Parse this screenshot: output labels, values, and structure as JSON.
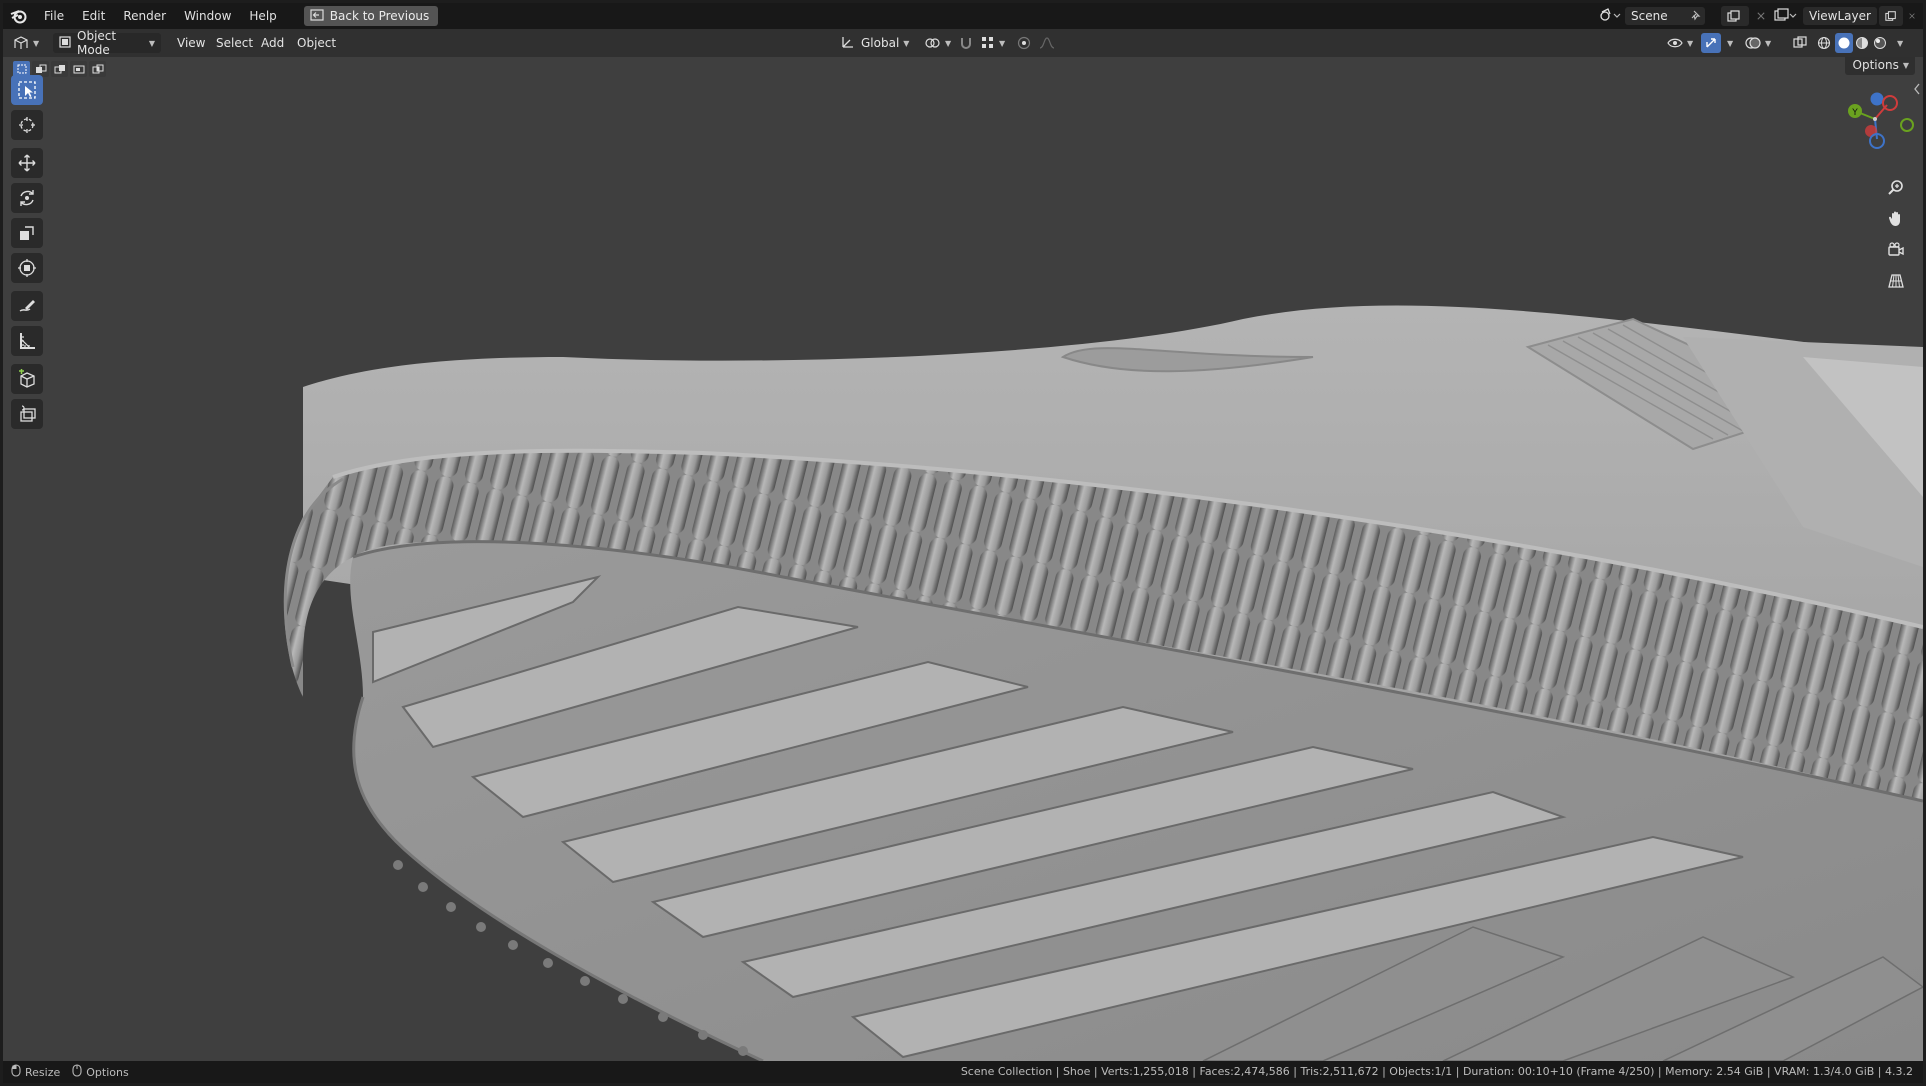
{
  "menubar": {
    "items": [
      "File",
      "Edit",
      "Render",
      "Window",
      "Help"
    ],
    "back_button": "Back to Previous",
    "scene_name": "Scene",
    "view_layer": "ViewLayer"
  },
  "header": {
    "mode": "Object Mode",
    "menus": [
      "View",
      "Select",
      "Add",
      "Object"
    ],
    "transform_orientation": "Global"
  },
  "viewport": {
    "options_label": "Options",
    "gizmo": {
      "x_label": "X",
      "y_label": "Y",
      "z_label": "Z"
    },
    "colors": {
      "background": "#3f3f3f",
      "model": "#a9a9a9",
      "accent_select": "#4872b8",
      "axis_x": "#d03c3c",
      "axis_y": "#6aa21f",
      "axis_z": "#3e73c8"
    }
  },
  "toolbar": {
    "tools": [
      "select-box",
      "cursor",
      "move",
      "rotate",
      "scale",
      "transform",
      "annotate",
      "measure",
      "add-cube",
      "extrude"
    ],
    "active": "select-box"
  },
  "statusbar": {
    "left": [
      {
        "icon": "mouse-icon",
        "label": "Resize"
      },
      {
        "icon": "mouse-icon",
        "label": "Options"
      }
    ],
    "info": "Scene Collection | Shoe | Verts:1,255,018 | Faces:2,474,586 | Tris:2,511,672 | Objects:1/1 | Duration: 00:10+10 (Frame 4/250) | Memory: 2.54 GiB | VRAM: 1.3/4.0 GiB | 4.3.2"
  }
}
